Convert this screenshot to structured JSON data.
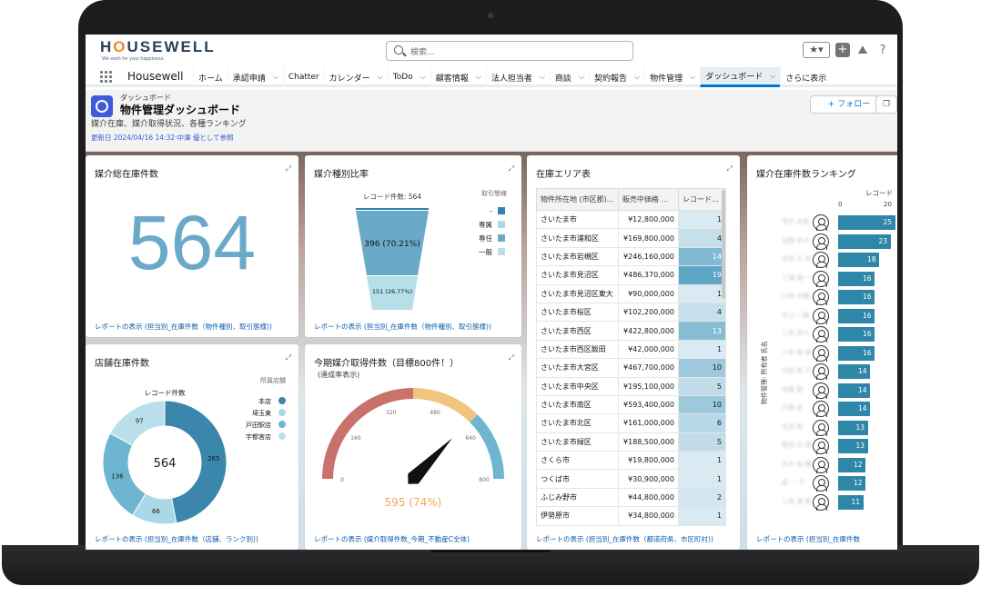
{
  "brand": {
    "logo": "HOUSEWELL",
    "tagline": "We wish for your happiness."
  },
  "search": {
    "placeholder": "検索..."
  },
  "nav": {
    "app_name": "Housewell",
    "items": [
      {
        "label": "ホーム",
        "chevron": false,
        "active": false
      },
      {
        "label": "承認申請",
        "chevron": true,
        "active": false
      },
      {
        "label": "Chatter",
        "chevron": false,
        "active": false
      },
      {
        "label": "カレンダー",
        "chevron": true,
        "active": false
      },
      {
        "label": "ToDo",
        "chevron": true,
        "active": false
      },
      {
        "label": "顧客情報",
        "chevron": true,
        "active": false
      },
      {
        "label": "法人担当者",
        "chevron": true,
        "active": false
      },
      {
        "label": "商談",
        "chevron": true,
        "active": false
      },
      {
        "label": "契約報告",
        "chevron": true,
        "active": false
      },
      {
        "label": "物件管理",
        "chevron": true,
        "active": false
      },
      {
        "label": "ダッシュボード",
        "chevron": true,
        "active": true
      },
      {
        "label": "さらに表示",
        "chevron": false,
        "active": false
      }
    ]
  },
  "header": {
    "subtitle": "ダッシュボード",
    "title": "物件管理ダッシュボード",
    "description": "媒介在庫、媒介取得状況、各種ランキング",
    "updated": "更新日 2024/04/16 14:32·中澤 優として参照",
    "follow_label": "+ フォロー"
  },
  "cards": {
    "total": {
      "title": "媒介総在庫件数",
      "value": "564",
      "footer": "レポートの表示 (担当別_在庫件数（物件種別、取引態様))"
    },
    "funnel": {
      "title": "媒介種別比率",
      "center_label": "レコード件数: 564",
      "legend_title": "取引態様",
      "legend": [
        {
          "label": "-",
          "color": "#2e86a8"
        },
        {
          "label": "専属",
          "color": "#a9d8e6"
        },
        {
          "label": "専任",
          "color": "#6aa9c8"
        },
        {
          "label": "一般",
          "color": "#b6dfe9"
        }
      ],
      "label_top": "396 (70.21%)",
      "label_bottom": "151 (26.77%)",
      "footer": "レポートの表示 (担当別_在庫件数（物件種別、取引態様))"
    },
    "area": {
      "title": "在庫エリア表",
      "headers": [
        "物件所在地 (市区郡)...",
        "販売中価格 ...",
        "レコード..."
      ],
      "rows": [
        [
          "さいたま市",
          "¥12,800,000",
          "1"
        ],
        [
          "さいたま市浦和区",
          "¥169,800,000",
          "4"
        ],
        [
          "さいたま市岩槻区",
          "¥246,160,000",
          "14"
        ],
        [
          "さいたま市見沼区",
          "¥486,370,000",
          "19"
        ],
        [
          "さいたま市見沼区東大",
          "¥90,000,000",
          "1"
        ],
        [
          "さいたま市桜区",
          "¥102,200,000",
          "4"
        ],
        [
          "さいたま市西区",
          "¥422,800,000",
          "13"
        ],
        [
          "さいたま市西区飯田",
          "¥42,000,000",
          "1"
        ],
        [
          "さいたま市大宮区",
          "¥467,700,000",
          "10"
        ],
        [
          "さいたま市中央区",
          "¥195,100,000",
          "5"
        ],
        [
          "さいたま市南区",
          "¥593,400,000",
          "10"
        ],
        [
          "さいたま市北区",
          "¥161,000,000",
          "6"
        ],
        [
          "さいたま市緑区",
          "¥188,500,000",
          "5"
        ],
        [
          "さくら市",
          "¥19,800,000",
          "1"
        ],
        [
          "つくば市",
          "¥30,900,000",
          "1"
        ],
        [
          "ふじみ野市",
          "¥44,800,000",
          "2"
        ],
        [
          "伊勢原市",
          "¥34,800,000",
          "1"
        ]
      ],
      "footer": "レポートの表示 (担当別_在庫件数（都道府県、市区町村))"
    },
    "ranking": {
      "title": "媒介在庫件数ランキング",
      "axis_label": "レコード",
      "ticks": [
        "0",
        "20"
      ],
      "ylabel": "物件管理: 所有者 氏名",
      "values": [
        25,
        23,
        18,
        16,
        16,
        16,
        16,
        16,
        14,
        14,
        14,
        13,
        13,
        12,
        12,
        11
      ],
      "names": [
        "荒井 尚美",
        "加藤 恭子",
        "吉田 大 明",
        "三浦 雄一",
        "小林 大輔",
        "村上 一雄",
        "三宅 学介",
        "三宅 智 雄",
        "石田 寛 行",
        "佐藤 聖",
        "大野 由",
        "丸田 明",
        "豊田 圭 陽",
        "石井 佑 輔",
        "森 一 子",
        "三宅 達 郎"
      ],
      "footer": "レポートの表示 (担当別_在庫件数"
    },
    "store": {
      "title": "店舗在庫件数",
      "center_label": "レコード件数",
      "total": "564",
      "legend_title": "所属店舗",
      "slices": [
        {
          "label": "本店",
          "value": 265,
          "color": "#3b87ab"
        },
        {
          "label": "埼玉東",
          "value": 66,
          "color": "#a9d8e6"
        },
        {
          "label": "戸田駅店",
          "value": 136,
          "color": "#6db5d1"
        },
        {
          "label": "宇都宮店",
          "value": 97,
          "color": "#b9e0ea"
        }
      ],
      "footer": "レポートの表示 (担当別_在庫件数（店舗、ランク別))"
    },
    "gauge": {
      "title": "今期媒介取得件数（目標800件！）",
      "subtitle": "(達成率表示)",
      "value": 595,
      "value_label": "595 (74%)",
      "min": 0,
      "max": 800,
      "ticks": [
        "0",
        "160",
        "320",
        "480",
        "640",
        "800"
      ],
      "bands": [
        {
          "from": 0,
          "to": 400,
          "color": "#c9716b"
        },
        {
          "from": 400,
          "to": 600,
          "color": "#f2c47f"
        },
        {
          "from": 600,
          "to": 800,
          "color": "#6db5d1"
        }
      ],
      "footer": "レポートの表示 (媒介取得件数_今期_不動産C全体)"
    }
  }
}
